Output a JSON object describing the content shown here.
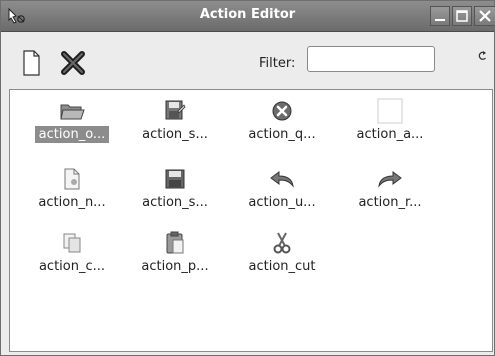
{
  "window": {
    "title": "Action Editor",
    "app_icon": "mouse-pointer-icon",
    "controls": [
      "minimize-icon",
      "maximize-icon",
      "close-icon"
    ]
  },
  "toolbar": {
    "new_button_icon": "new-document-icon",
    "delete_button_icon": "delete-x-icon",
    "filter_label": "Filter:",
    "filter_value": "",
    "clear_icon": "clear-filter-icon"
  },
  "actions": [
    {
      "label": "action_o...",
      "icon": "folder-open-icon",
      "selected": true
    },
    {
      "label": "action_s...",
      "icon": "save-as-icon",
      "selected": false
    },
    {
      "label": "action_q...",
      "icon": "quit-icon",
      "selected": false
    },
    {
      "label": "action_a...",
      "icon": "blank-icon",
      "selected": false
    },
    {
      "label": "action_n...",
      "icon": "new-file-icon",
      "selected": false
    },
    {
      "label": "action_s...",
      "icon": "floppy-save-icon",
      "selected": false
    },
    {
      "label": "action_u...",
      "icon": "undo-icon",
      "selected": false
    },
    {
      "label": "action_r...",
      "icon": "redo-icon",
      "selected": false
    },
    {
      "label": "action_c...",
      "icon": "copy-icon",
      "selected": false
    },
    {
      "label": "action_p...",
      "icon": "paste-icon",
      "selected": false
    },
    {
      "label": "action_cut",
      "icon": "scissors-icon",
      "selected": false
    }
  ]
}
